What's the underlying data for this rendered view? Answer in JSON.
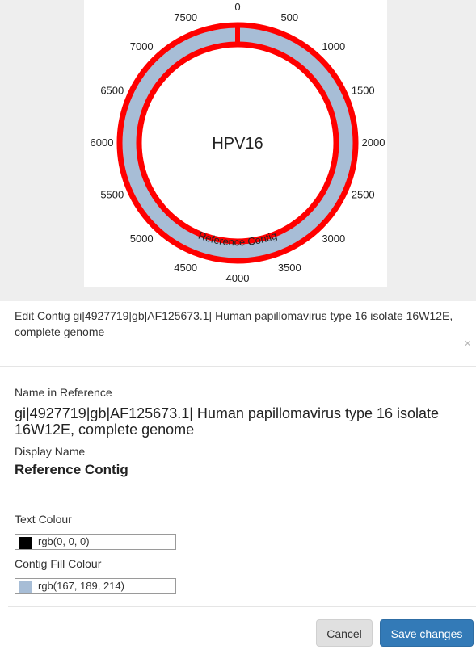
{
  "plot": {
    "title": "HPV16",
    "contig_label": "Reference Contig",
    "ticks": [
      "0",
      "500",
      "1000",
      "1500",
      "2000",
      "2500",
      "3000",
      "3500",
      "4000",
      "4500",
      "5000",
      "5500",
      "6000",
      "6500",
      "7000",
      "7500"
    ],
    "colors": {
      "ring_stroke": "#ff0000",
      "contig_fill": "#a7bdd6"
    }
  },
  "modal": {
    "title": "Edit Contig gi|4927719|gb|AF125673.1| Human papillomavirus type 16 isolate 16W12E, complete genome",
    "close_glyph": "×"
  },
  "form": {
    "name_in_reference_label": "Name in Reference",
    "name_in_reference_value": "gi|4927719|gb|AF125673.1| Human papillomavirus type 16 isolate 16W12E, complete genome",
    "display_name_label": "Display Name",
    "display_name_value": "Reference Contig",
    "text_colour_label": "Text Colour",
    "text_colour_value": "rgb(0, 0, 0)",
    "text_colour_swatch": "#000000",
    "fill_colour_label": "Contig Fill Colour",
    "fill_colour_value": "rgb(167, 189, 214)",
    "fill_colour_swatch": "#a7bdd6"
  },
  "footer": {
    "cancel_label": "Cancel",
    "save_label": "Save changes"
  }
}
